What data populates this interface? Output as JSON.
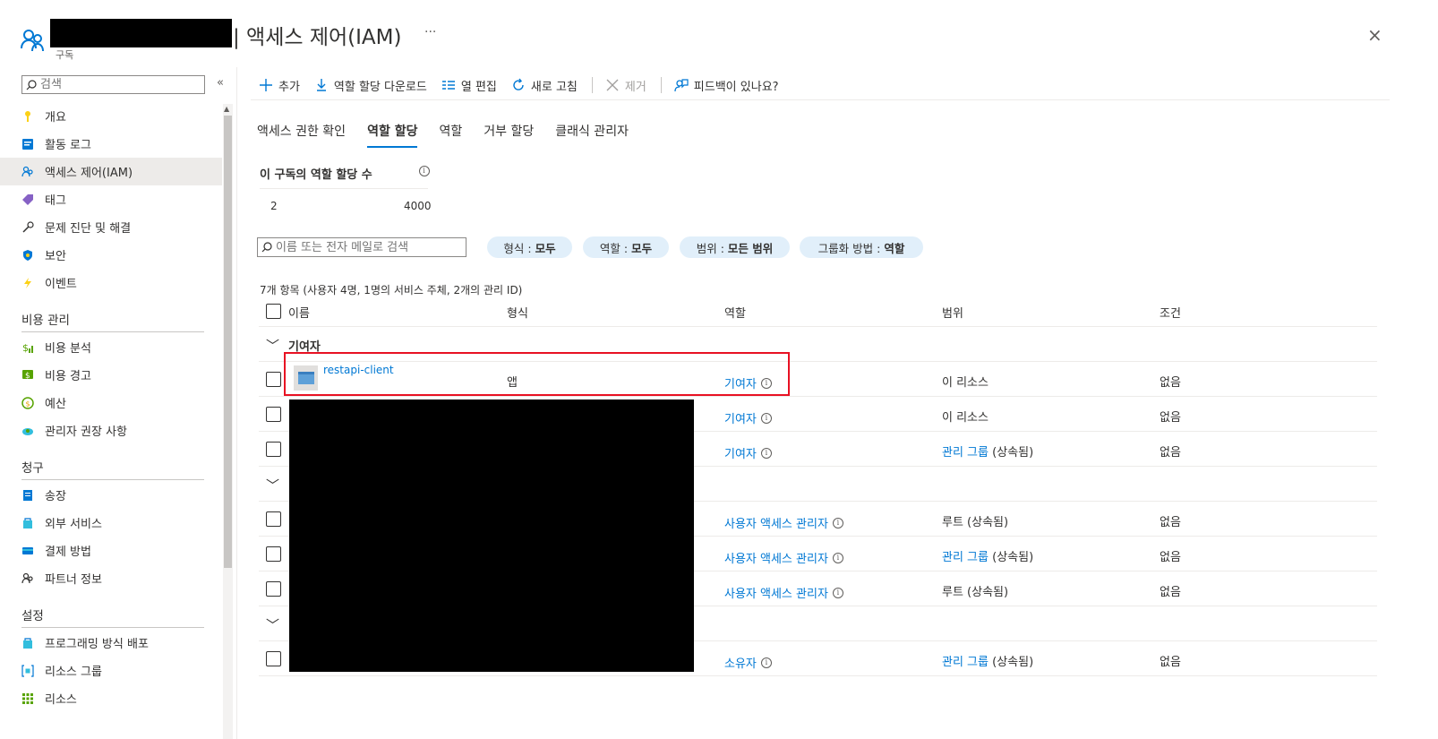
{
  "header": {
    "title": "| 액세스 제어(IAM)",
    "subtitle": "구독",
    "more": "···",
    "close": "×"
  },
  "sidebar": {
    "search_placeholder": "검색",
    "collapse": "«",
    "items": [
      {
        "label": "개요",
        "icon": "key-icon"
      },
      {
        "label": "활동 로그",
        "icon": "log-icon"
      },
      {
        "label": "액세스 제어(IAM)",
        "icon": "people-icon",
        "active": true
      },
      {
        "label": "태그",
        "icon": "tag-icon"
      },
      {
        "label": "문제 진단 및 해결",
        "icon": "wrench-icon"
      },
      {
        "label": "보안",
        "icon": "shield-icon"
      },
      {
        "label": "이벤트",
        "icon": "lightning-icon"
      }
    ],
    "section_cost": "비용 관리",
    "cost_items": [
      {
        "label": "비용 분석",
        "icon": "cost-analysis-icon"
      },
      {
        "label": "비용 경고",
        "icon": "cost-alert-icon"
      },
      {
        "label": "예산",
        "icon": "budget-icon"
      },
      {
        "label": "관리자 권장 사항",
        "icon": "advisor-icon"
      }
    ],
    "section_billing": "청구",
    "billing_items": [
      {
        "label": "송장",
        "icon": "invoice-icon"
      },
      {
        "label": "외부 서비스",
        "icon": "external-services-icon"
      },
      {
        "label": "결제 방법",
        "icon": "payment-icon"
      },
      {
        "label": "파트너 정보",
        "icon": "partner-icon"
      }
    ],
    "section_settings": "설정",
    "settings_items": [
      {
        "label": "프로그래밍 방식 배포",
        "icon": "deploy-icon"
      },
      {
        "label": "리소스 그룹",
        "icon": "resource-group-icon"
      },
      {
        "label": "리소스",
        "icon": "grid-icon"
      }
    ]
  },
  "toolbar": {
    "add": "추가",
    "download": "역할 할당 다운로드",
    "edit_columns": "열 편집",
    "refresh": "새로 고침",
    "remove": "제거",
    "feedback": "피드백이 있나요?"
  },
  "tabs": [
    "액세스 권한 확인",
    "역할 할당",
    "역할",
    "거부 할당",
    "클래식 관리자"
  ],
  "active_tab": "역할 할당",
  "count": {
    "title": "이 구독의 역할 할당 수",
    "current": "2",
    "max": "4000"
  },
  "filter": {
    "search_placeholder": "이름 또는 전자 메일로 검색",
    "type_label": "형식 :",
    "type_value": "모두",
    "role_label": "역할 :",
    "role_value": "모두",
    "scope_label": "범위 :",
    "scope_value": "모든 범위",
    "group_label": "그룹화 방법 :",
    "group_value": "역할"
  },
  "list": {
    "summary": "7개 항목 (사용자 4명, 1명의 서비스 주체, 2개의 관리 ID)",
    "columns": {
      "name": "이름",
      "type": "형식",
      "role": "역할",
      "scope": "범위",
      "condition": "조건"
    },
    "group1": "기여자",
    "rows": [
      {
        "name": "restapi-client",
        "type": "앱",
        "role": "기여자",
        "scope": "이 리소스",
        "scope_link": "",
        "condition": "없음"
      },
      {
        "name": "",
        "type": "",
        "role": "기여자",
        "scope": "이 리소스",
        "scope_link": "",
        "condition": "없음"
      },
      {
        "name": "",
        "type": "",
        "role": "기여자",
        "scope": "(상속됨)",
        "scope_link": "관리 그룹",
        "condition": "없음"
      },
      {
        "name": "",
        "type": "",
        "role": "사용자 액세스 관리자",
        "scope": "루트 (상속됨)",
        "scope_link": "",
        "condition": "없음"
      },
      {
        "name": "",
        "type": "",
        "role": "사용자 액세스 관리자",
        "scope": "(상속됨)",
        "scope_link": "관리 그룹",
        "condition": "없음"
      },
      {
        "name": "",
        "type": "",
        "role": "사용자 액세스 관리자",
        "scope": "루트 (상속됨)",
        "scope_link": "",
        "condition": "없음"
      },
      {
        "name": "",
        "type": "",
        "role": "소유자",
        "scope": "(상속됨)",
        "scope_link": "관리 그룹",
        "condition": "없음"
      }
    ]
  },
  "colors": {
    "accent": "#0078d4",
    "highlight": "#e81123",
    "pill": "#e1effa"
  }
}
